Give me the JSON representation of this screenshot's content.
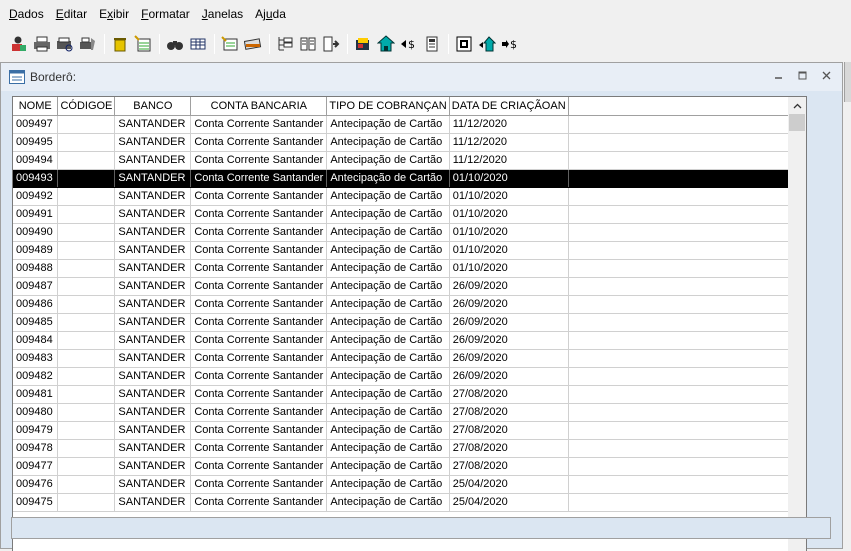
{
  "menu": [
    {
      "label": "Dados"
    },
    {
      "label": "Editar"
    },
    {
      "label": "Exibir"
    },
    {
      "label": "Formatar"
    },
    {
      "label": "Janelas"
    },
    {
      "label": "Ajuda"
    }
  ],
  "window": {
    "title": "Borderô:"
  },
  "table": {
    "columns": [
      "NOME",
      "CÓDIGOE",
      "BANCO",
      "CONTA BANCARIA",
      "TIPO DE COBRANÇAN",
      "DATA DE CRIAÇÃOAN"
    ],
    "selected_index": 3,
    "rows": [
      [
        "009497",
        "",
        "SANTANDER",
        "Conta Corrente Santander",
        "Antecipação de Cartão",
        "11/12/2020"
      ],
      [
        "009495",
        "",
        "SANTANDER",
        "Conta Corrente Santander",
        "Antecipação de Cartão",
        "11/12/2020"
      ],
      [
        "009494",
        "",
        "SANTANDER",
        "Conta Corrente Santander",
        "Antecipação de Cartão",
        "11/12/2020"
      ],
      [
        "009493",
        "",
        "SANTANDER",
        "Conta Corrente Santander",
        "Antecipação de Cartão",
        "01/10/2020"
      ],
      [
        "009492",
        "",
        "SANTANDER",
        "Conta Corrente Santander",
        "Antecipação de Cartão",
        "01/10/2020"
      ],
      [
        "009491",
        "",
        "SANTANDER",
        "Conta Corrente Santander",
        "Antecipação de Cartão",
        "01/10/2020"
      ],
      [
        "009490",
        "",
        "SANTANDER",
        "Conta Corrente Santander",
        "Antecipação de Cartão",
        "01/10/2020"
      ],
      [
        "009489",
        "",
        "SANTANDER",
        "Conta Corrente Santander",
        "Antecipação de Cartão",
        "01/10/2020"
      ],
      [
        "009488",
        "",
        "SANTANDER",
        "Conta Corrente Santander",
        "Antecipação de Cartão",
        "01/10/2020"
      ],
      [
        "009487",
        "",
        "SANTANDER",
        "Conta Corrente Santander",
        "Antecipação de Cartão",
        "26/09/2020"
      ],
      [
        "009486",
        "",
        "SANTANDER",
        "Conta Corrente Santander",
        "Antecipação de Cartão",
        "26/09/2020"
      ],
      [
        "009485",
        "",
        "SANTANDER",
        "Conta Corrente Santander",
        "Antecipação de Cartão",
        "26/09/2020"
      ],
      [
        "009484",
        "",
        "SANTANDER",
        "Conta Corrente Santander",
        "Antecipação de Cartão",
        "26/09/2020"
      ],
      [
        "009483",
        "",
        "SANTANDER",
        "Conta Corrente Santander",
        "Antecipação de Cartão",
        "26/09/2020"
      ],
      [
        "009482",
        "",
        "SANTANDER",
        "Conta Corrente Santander",
        "Antecipação de Cartão",
        "26/09/2020"
      ],
      [
        "009481",
        "",
        "SANTANDER",
        "Conta Corrente Santander",
        "Antecipação de Cartão",
        "27/08/2020"
      ],
      [
        "009480",
        "",
        "SANTANDER",
        "Conta Corrente Santander",
        "Antecipação de Cartão",
        "27/08/2020"
      ],
      [
        "009479",
        "",
        "SANTANDER",
        "Conta Corrente Santander",
        "Antecipação de Cartão",
        "27/08/2020"
      ],
      [
        "009478",
        "",
        "SANTANDER",
        "Conta Corrente Santander",
        "Antecipação de Cartão",
        "27/08/2020"
      ],
      [
        "009477",
        "",
        "SANTANDER",
        "Conta Corrente Santander",
        "Antecipação de Cartão",
        "27/08/2020"
      ],
      [
        "009476",
        "",
        "SANTANDER",
        "Conta Corrente Santander",
        "Antecipação de Cartão",
        "25/04/2020"
      ],
      [
        "009475",
        "",
        "SANTANDER",
        "Conta Corrente Santander",
        "Antecipação de Cartão",
        "25/04/2020"
      ]
    ]
  },
  "toolbar": {
    "icons": [
      "user-export-icon",
      "print-icon",
      "print-preview-icon",
      "printer-setup-icon",
      "delete-icon",
      "new-record-icon",
      "find-icon",
      "grid-view-icon",
      "properties-icon",
      "payment-icon",
      "tree-icon",
      "columns-icon",
      "export-icon",
      "report-icon",
      "home-icon",
      "transfer-in-icon",
      "calculator-icon",
      "list-icon",
      "house-back-icon",
      "transfer-out-icon"
    ]
  },
  "colors": {
    "selected_row_bg": "#000000",
    "mdi_background": "#dbe6f2"
  }
}
